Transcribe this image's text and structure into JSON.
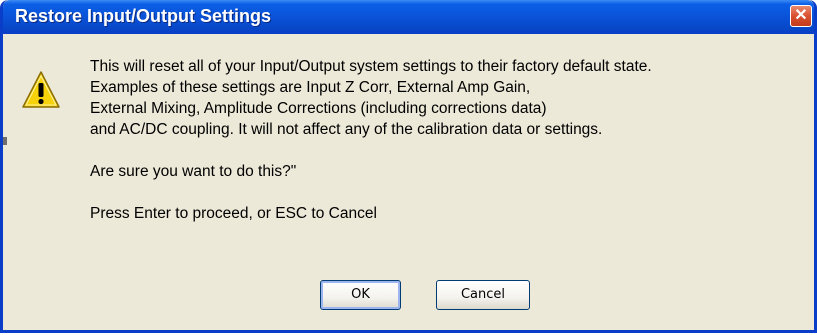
{
  "window": {
    "title": "Restore Input/Output Settings",
    "close_label": "✕"
  },
  "icon": {
    "name": "warning-icon",
    "color": "#f5d20a"
  },
  "message": {
    "lines": [
      "This will reset all of your Input/Output system settings to their factory default state.",
      "Examples of these settings are Input Z Corr, External Amp Gain,",
      "External Mixing, Amplitude Corrections (including corrections data)",
      "and AC/DC coupling.  It will not affect any of the calibration data or settings."
    ],
    "question": "Are sure you want to do this?\"",
    "instruction": "Press Enter to proceed, or ESC to Cancel"
  },
  "buttons": {
    "ok_label": "OK",
    "cancel_label": "Cancel"
  },
  "colors": {
    "titlebar": "#0a53d9",
    "dialog_bg": "#ece9d8",
    "close_button": "#d9512f"
  }
}
